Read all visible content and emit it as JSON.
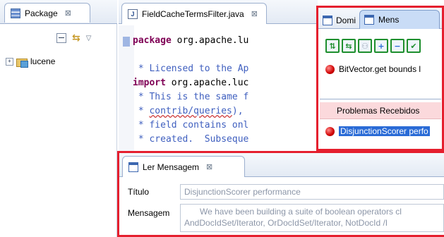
{
  "package_view": {
    "tab_label": "Package",
    "close_glyph": "⊠",
    "tree": [
      {
        "expander": "+",
        "label": "lucene",
        "icon": "package-folder-icon"
      }
    ]
  },
  "editor": {
    "tab_label": "FieldCacheTermsFilter.java",
    "close_glyph": "⊠",
    "code_lines": [
      {
        "segments": [
          {
            "cls": "kw",
            "text": "package"
          },
          {
            "cls": "pl",
            "text": " org.apache.lu"
          }
        ]
      },
      {
        "segments": [
          {
            "cls": "pl",
            "text": ""
          }
        ]
      },
      {
        "fold": "+",
        "segments": [
          {
            "cls": "cm",
            "text": " * Licensed to the Ap"
          }
        ]
      },
      {
        "fold": "+",
        "segments": [
          {
            "cls": "kw",
            "text": "import"
          },
          {
            "cls": "pl",
            "text": " org.apache.luc"
          }
        ]
      },
      {
        "segments": [
          {
            "cls": "cm",
            "text": " * This is the same f"
          }
        ]
      },
      {
        "segments": [
          {
            "cls": "cm",
            "text": " * "
          },
          {
            "cls": "cm wavy",
            "text": "contrib/queries"
          },
          {
            "cls": "cm",
            "text": "),"
          }
        ]
      },
      {
        "segments": [
          {
            "cls": "cm",
            "text": " * field contains onl"
          }
        ]
      },
      {
        "segments": [
          {
            "cls": "cm",
            "text": " * created.  Subseque"
          }
        ]
      }
    ]
  },
  "messages_view": {
    "tabs": [
      {
        "label": "Domi"
      },
      {
        "label": "Mens"
      }
    ],
    "toolbar": [
      {
        "name": "send-message-button",
        "glyph": "⇅",
        "color": "#1e8f2e"
      },
      {
        "name": "forward-message-button",
        "glyph": "⇆",
        "color": "#1e8f2e"
      },
      {
        "name": "users-disabled-button",
        "glyph": "⚇",
        "color": "#9aa3b0"
      },
      {
        "name": "add-button",
        "glyph": "+",
        "color": "#2a6bd6"
      },
      {
        "name": "minimize-button",
        "glyph": "−",
        "color": "#2a6bd6"
      },
      {
        "name": "check-button",
        "glyph": "✔",
        "color": "#1e8f2e"
      }
    ],
    "sent": [
      {
        "label": "BitVector.get bounds l"
      }
    ],
    "received_header": "Problemas Recebidos",
    "received": [
      {
        "label": "DisjunctionScorer perfo"
      }
    ]
  },
  "read_message": {
    "tab_label": "Ler Mensagem",
    "close_glyph": "⊠",
    "title_label": "Título",
    "title_value": "DisjunctionScorer performance",
    "message_label": "Mensagem",
    "message_line1": "We have been building a suite of boolean operators\tcl",
    "message_line2": "AndDocIdSet/Iterator, OrDocIdSet/Iterator, NotDocId\t/I"
  }
}
